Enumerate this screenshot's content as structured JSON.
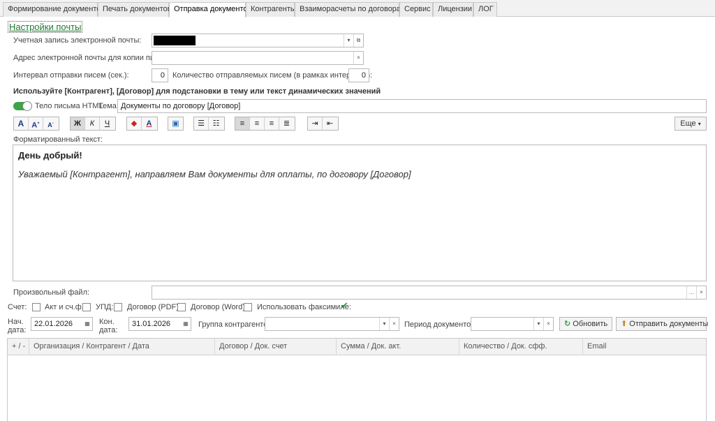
{
  "tabs": [
    {
      "label": "Формирование документов"
    },
    {
      "label": "Печать документов"
    },
    {
      "label": "Отправка документов"
    },
    {
      "label": "Контрагенты"
    },
    {
      "label": "Взаиморасчеты по договорам"
    },
    {
      "label": "Сервис"
    },
    {
      "label": "Лицензии"
    },
    {
      "label": "ЛОГ"
    }
  ],
  "active_tab": "Отправка документов",
  "mail_settings_link": "Настройки почты",
  "email_account": {
    "label": "Учетная запись электронной почты:",
    "value": ""
  },
  "copy_email": {
    "label": "Адрес электронной почты для копии писем:",
    "value": ""
  },
  "interval": {
    "label": "Интервал отправки писем (сек.):",
    "value": "0"
  },
  "count": {
    "label": "Количество отправляемых писем (в рамках интервала):",
    "value": "0"
  },
  "hint": "Используйте [Контрагент], [Договор] для подстановки в тему или текст динамических значений",
  "html_toggle": {
    "label": "Тело письма HTML",
    "on": true
  },
  "subject": {
    "label": "Тема:",
    "value": "Документы по договору [Договор]"
  },
  "toolbar": {
    "font_group": [
      "A",
      "A",
      "A"
    ],
    "style_group": [
      "Ж",
      "К",
      "Ч"
    ],
    "more_label": "Еще"
  },
  "formatted_text": {
    "label": "Форматированный текст:",
    "heading": "День добрый!",
    "body": "Уважаемый [Контрагент], направляем Вам документы для оплаты, по договору [Договор]"
  },
  "custom_file": {
    "label": "Произвольный файл:",
    "value": ""
  },
  "checkboxes": {
    "schet": {
      "label": "Счет:",
      "checked": false
    },
    "akt": {
      "label": "Акт и сч.ф.:",
      "checked": false
    },
    "upd": {
      "label": "УПД:",
      "checked": false
    },
    "dogovor_pdf": {
      "label": "Договор (PDF):",
      "checked": false
    },
    "dogovor_word": {
      "label": "Договор (Word):",
      "checked": false
    },
    "facsimile": {
      "label": "Использовать факсимиле:",
      "checked": true
    }
  },
  "start_date": {
    "label_1": "Нач.",
    "label_2": "дата:",
    "value": "22.01.2026"
  },
  "end_date": {
    "label_1": "Кон.",
    "label_2": "дата:",
    "value": "31.01.2026"
  },
  "contractor_group": {
    "label": "Группа контрагентов:",
    "value": ""
  },
  "doc_period": {
    "label": "Период документов:",
    "value": ""
  },
  "buttons": {
    "refresh": "Обновить",
    "send": "Отправить документы"
  },
  "table": {
    "columns": [
      "+ / -",
      "Организация / Контрагент / Дата",
      "Договор / Док. счет",
      "Сумма / Док. акт.",
      "Количество / Док. сфф.",
      "Email"
    ]
  },
  "colors": {
    "accent_green": "#3ea44a",
    "link_green": "#1a7a2e"
  }
}
